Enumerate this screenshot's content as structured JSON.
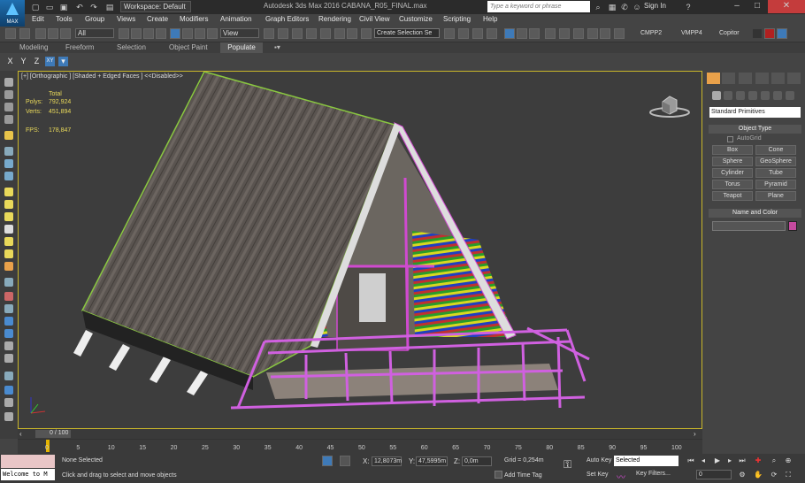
{
  "titlebar": {
    "logo_text": "MAX",
    "workspace": "Workspace: Default",
    "app_title": "Autodesk 3ds Max 2016   CABANA_R05_FINAL.max",
    "search_placeholder": "Type a keyword or phrase",
    "sign_in": "Sign In"
  },
  "menu": [
    "Edit",
    "Tools",
    "Group",
    "Views",
    "Create",
    "Modifiers",
    "Animation",
    "Graph Editors",
    "Rendering",
    "Civil View",
    "Customize",
    "Scripting",
    "Help"
  ],
  "toolbar": {
    "selection_filter": "All",
    "ref_coord": "View",
    "named_selection": "Create Selection Se",
    "scripts": [
      "CMPP2",
      "VMPP4",
      "Copitor"
    ]
  },
  "ribbon": {
    "tabs": [
      "Modeling",
      "Freeform",
      "Selection",
      "Object Paint",
      "Populate"
    ],
    "active": "Populate"
  },
  "axis": {
    "buttons": [
      "X",
      "Y",
      "Z",
      "XY"
    ]
  },
  "viewport": {
    "label": "[+] [Orthographic ] [Shaded + Edged Faces ]  <<Disabled>>",
    "stats": {
      "total_label": "Total",
      "polys_label": "Polys:",
      "polys": "792,924",
      "verts_label": "Verts:",
      "verts": "451,894",
      "fps_label": "FPS:",
      "fps": "178,847"
    }
  },
  "command_panel": {
    "primitive_type": "Standard Primitives",
    "object_type_title": "Object Type",
    "autogrid": "AutoGrid",
    "objects": [
      "Box",
      "Cone",
      "Sphere",
      "GeoSphere",
      "Cylinder",
      "Tube",
      "Torus",
      "Pyramid",
      "Teapot",
      "Plane"
    ],
    "name_color_title": "Name and Color",
    "color": "#c64a9f"
  },
  "timeline": {
    "frame_label": "0 / 100",
    "ticks": [
      "0",
      "5",
      "10",
      "15",
      "20",
      "25",
      "30",
      "35",
      "40",
      "45",
      "50",
      "55",
      "60",
      "65",
      "70",
      "75",
      "80",
      "85",
      "90",
      "95",
      "100"
    ]
  },
  "status": {
    "maxscript_welcome": "Welcome to M",
    "selection": "None Selected",
    "prompt": "Click and drag to select and move objects",
    "x_label": "X:",
    "x": "12,8073m",
    "y_label": "Y:",
    "y": "47,5995m",
    "z_label": "Z:",
    "z": "0,0m",
    "grid": "Grid = 0,254m",
    "add_time_tag": "Add Time Tag",
    "auto_key": "Auto Key",
    "set_key": "Set Key",
    "key_mode": "Selected",
    "key_filters": "Key Filters...",
    "frame": "0"
  }
}
